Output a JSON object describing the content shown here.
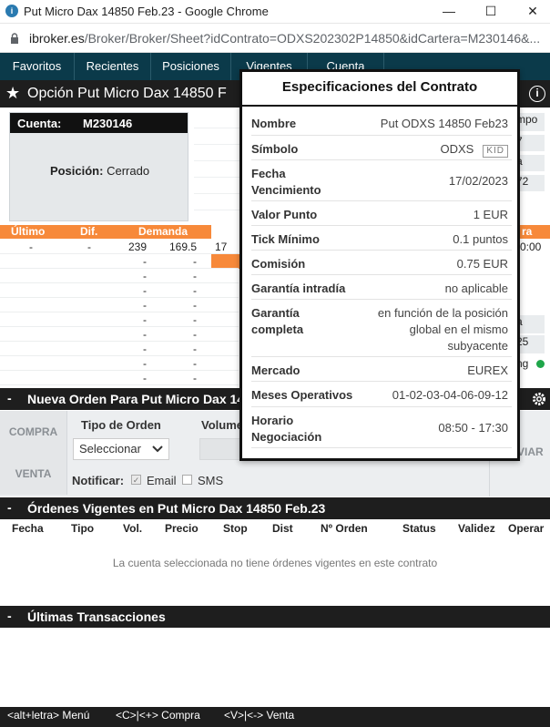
{
  "window": {
    "title": "Put Micro Dax 14850 Feb.23 - Google Chrome",
    "url_host": "ibroker.es",
    "url_path": "/Broker/Broker/Sheet?idContrato=ODXS202302P14850&idCartera=M230146&..."
  },
  "nav": {
    "tabs": [
      {
        "label": "Favoritos"
      },
      {
        "label": "Recientes"
      },
      {
        "label": "Posiciones"
      },
      {
        "label": "Vigentes"
      },
      {
        "label": "Cuenta"
      }
    ]
  },
  "header": {
    "title": "Opción Put Micro Dax 14850 F"
  },
  "account": {
    "label": "Cuenta:",
    "id": "M230146",
    "position_label": "Posición:",
    "position_value": "Cerrado"
  },
  "right_stubs": {
    "a": "mpo",
    "b": "7",
    "c": "a",
    "d": "72",
    "e": "a",
    "f": "25",
    "g": "ng"
  },
  "quotes": {
    "headers": [
      "Último",
      "Dif.",
      "Demanda"
    ],
    "rows": [
      [
        "-",
        "-",
        "239",
        "169.5",
        "17"
      ],
      [
        "",
        "",
        "-",
        "-",
        ""
      ],
      [
        "",
        "",
        "-",
        "-",
        ""
      ],
      [
        "",
        "",
        "-",
        "-",
        ""
      ],
      [
        "",
        "",
        "-",
        "-",
        ""
      ],
      [
        "",
        "",
        "-",
        "-",
        ""
      ],
      [
        "",
        "",
        "-",
        "-",
        ""
      ],
      [
        "",
        "",
        "-",
        "-",
        ""
      ],
      [
        "",
        "",
        "-",
        "-",
        ""
      ],
      [
        "",
        "",
        "-",
        "-",
        ""
      ]
    ],
    "right_header": "ra",
    "right_time": "0:00"
  },
  "new_order": {
    "title": "Nueva Orden Para Put Micro Dax 14",
    "buy": "COMPRA",
    "sell": "VENTA",
    "order_type_label": "Tipo de Orden",
    "order_type_value": "Seleccionar",
    "volume_label": "Volume",
    "notify_label": "Notificar:",
    "email": "Email",
    "sms": "SMS",
    "send_stub": "VIAR"
  },
  "active_orders": {
    "title": "Órdenes Vigentes en Put Micro Dax 14850 Feb.23",
    "columns": [
      "Fecha",
      "Tipo",
      "Vol.",
      "Precio",
      "Stop",
      "Dist",
      "Nº Orden",
      "Status",
      "Validez",
      "Operar"
    ],
    "empty_message": "La cuenta seleccionada no tiene órdenes vigentes en este contrato"
  },
  "last_trades": {
    "title": "Últimas Transacciones"
  },
  "footer": {
    "menu": "<alt+letra> Menú",
    "buy": "<C>|<+> Compra",
    "sell": "<V>|<-> Venta"
  },
  "spec": {
    "title": "Especificaciones del Contrato",
    "rows": [
      {
        "k": "Nombre",
        "v": "Put ODXS 14850 Feb23"
      },
      {
        "k": "Símbolo",
        "v": "ODXS",
        "badge": "KID"
      },
      {
        "k": "Fecha Vencimiento",
        "v": "17/02/2023"
      },
      {
        "k": "Valor Punto",
        "v": "1 EUR"
      },
      {
        "k": "Tick Mínimo",
        "v": "0.1 puntos"
      },
      {
        "k": "Comisión",
        "v": "0.75 EUR"
      },
      {
        "k": "Garantía intradía",
        "v": "no aplicable"
      },
      {
        "k": "Garantía completa",
        "v": "en función de la posición global en el mismo subyacente"
      },
      {
        "k": "Mercado",
        "v": "EUREX"
      },
      {
        "k": "Meses Operativos",
        "v": "01-02-03-04-06-09-12"
      },
      {
        "k": "Horario Negociación",
        "v": "08:50 - 17:30"
      }
    ]
  },
  "colors": {
    "nav": "#0b3a4a",
    "accent": "#f7893a",
    "dark": "#1e1e1e",
    "status_dot": "#1fa64a"
  }
}
